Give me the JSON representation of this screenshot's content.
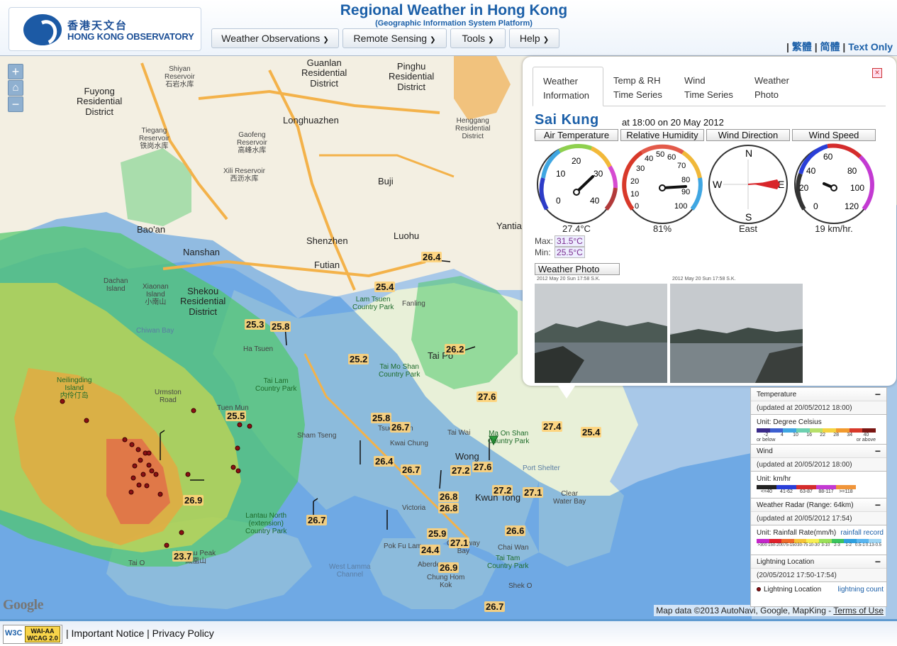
{
  "header": {
    "logo_cn": "香港天文台",
    "logo_en": "HONG KONG OBSERVATORY",
    "title": "Regional Weather in Hong Kong",
    "subtitle": "(Geographic Information System Platform)",
    "menu": [
      "Weather Observations",
      "Remote Sensing",
      "Tools",
      "Help"
    ],
    "lang": {
      "traditional": "繁體",
      "simplified": "简體",
      "text_only": "Text Only",
      "separator": "|"
    }
  },
  "map": {
    "zoom_in": "+",
    "home": "⌂",
    "zoom_out": "−",
    "google": "Google",
    "attribution": "Map data ©2013 AutoNavi, Google, MapKing - ",
    "terms": "Terms of Use",
    "labels": [
      {
        "text": "Shiyan\nReservoir\n石岩水库",
        "cls": ""
      },
      {
        "text": "Fuyong\nResidential\nDistrict",
        "cls": "big"
      },
      {
        "text": "Tiegang\nReservoir\n铁岗水库",
        "cls": ""
      },
      {
        "text": "Guanlan\nResidential\nDistrict",
        "cls": "big"
      },
      {
        "text": "Pinghu\nResidential\nDistrict",
        "cls": "big"
      },
      {
        "text": "Longhuazhen",
        "cls": "big"
      },
      {
        "text": "Gaofeng\nReservoir\n高峰水库",
        "cls": ""
      },
      {
        "text": "Xili Reservoir\n西沥水库",
        "cls": ""
      },
      {
        "text": "Bao'an",
        "cls": "big"
      },
      {
        "text": "Shenzhen",
        "cls": "big"
      },
      {
        "text": "Luohu",
        "cls": "big"
      },
      {
        "text": "Futian",
        "cls": "big"
      },
      {
        "text": "Nanshan",
        "cls": "big"
      },
      {
        "text": "Buji",
        "cls": "big"
      },
      {
        "text": "Henggang\nResidential\nDistrict",
        "cls": ""
      },
      {
        "text": "Shekou\nResidential\nDistrict",
        "cls": "big"
      },
      {
        "text": "Chiwan Bay",
        "cls": "water"
      },
      {
        "text": "Neilingding\nIsland\n内伶仃岛",
        "cls": "park"
      },
      {
        "text": "Tai Lam\nCountry Park",
        "cls": "park"
      },
      {
        "text": "Tuen Mun",
        "cls": ""
      },
      {
        "text": "Ha Tsuen",
        "cls": ""
      },
      {
        "text": "Lam Tsuen\nCountry Park",
        "cls": "park"
      },
      {
        "text": "Fanling",
        "cls": ""
      },
      {
        "text": "Tai Po",
        "cls": "big"
      },
      {
        "text": "Tai Mo Shan\nCountry Park",
        "cls": "park"
      },
      {
        "text": "Tsuen Wan",
        "cls": ""
      },
      {
        "text": "Kwai Chung",
        "cls": ""
      },
      {
        "text": "Tai Wai",
        "cls": ""
      },
      {
        "text": "Ma On Shan\nCountry Park",
        "cls": "park"
      },
      {
        "text": "Wong",
        "cls": "big"
      },
      {
        "text": "Kwun Tong",
        "cls": "big"
      },
      {
        "text": "Port Shelter",
        "cls": "water"
      },
      {
        "text": "Clear\nWater Bay",
        "cls": ""
      },
      {
        "text": "Lantau North\n(extension)\nCountry Park",
        "cls": "park"
      },
      {
        "text": "Lantau Peak\n鳳凰山",
        "cls": ""
      },
      {
        "text": "Tai O",
        "cls": ""
      },
      {
        "text": "Victoria",
        "cls": ""
      },
      {
        "text": "Causeway\nBay",
        "cls": ""
      },
      {
        "text": "Pok Fu Lam",
        "cls": ""
      },
      {
        "text": "West Lamma\nChannel",
        "cls": "water"
      },
      {
        "text": "Aberdeen",
        "cls": ""
      },
      {
        "text": "Chai Wan",
        "cls": ""
      },
      {
        "text": "Tai Tam\nCountry Park",
        "cls": "park"
      },
      {
        "text": "Shek O",
        "cls": ""
      },
      {
        "text": "Chung Hom\nKok",
        "cls": ""
      },
      {
        "text": "Sham Tseng",
        "cls": ""
      },
      {
        "text": "Dachan\nIsland",
        "cls": ""
      },
      {
        "text": "Xiaonan\nIsland\n小南山",
        "cls": ""
      },
      {
        "text": "Urmston\nRoad",
        "cls": ""
      },
      {
        "text": "Yantia",
        "cls": "big"
      }
    ],
    "temps": [
      "26.4",
      "25.4",
      "25.3",
      "25.8",
      "25.2",
      "26.2",
      "25.5",
      "25.8",
      "26.7",
      "27.6",
      "27.4",
      "25.4",
      "26.4",
      "26.7",
      "27.2",
      "27.6",
      "27.2",
      "27.1",
      "26.8",
      "26.8",
      "26.9",
      "26.7",
      "25.9",
      "24.4",
      "27.1",
      "26.6",
      "26.9",
      "26.7",
      "23.7"
    ]
  },
  "info": {
    "tabs": [
      {
        "l1": "Weather",
        "l2": "Information"
      },
      {
        "l1": "Temp & RH",
        "l2": "Time Series"
      },
      {
        "l1": "Wind",
        "l2": "Time Series"
      },
      {
        "l1": "Weather",
        "l2": "Photo"
      }
    ],
    "close": "×",
    "station": "Sai Kung",
    "time": "at 18:00 on 20 May 2012",
    "gauges": {
      "air_temp": {
        "header": "Air Temperature",
        "value": "27.4°C",
        "reading": 27.4,
        "ticks": [
          "10",
          "20",
          "30",
          "0",
          "40"
        ]
      },
      "humidity": {
        "header": "Relative Humidity",
        "value": "81%",
        "reading": 81,
        "ticks": [
          "30",
          "40",
          "50",
          "60",
          "70",
          "20",
          "80",
          "10",
          "90",
          "0",
          "100"
        ]
      },
      "wind_dir": {
        "header": "Wind Direction",
        "value": "East",
        "ticks": [
          "N",
          "W",
          "E",
          "S"
        ]
      },
      "wind_speed": {
        "header": "Wind Speed",
        "value": "19 km/hr.",
        "reading": 19,
        "ticks": [
          "40",
          "60",
          "20",
          "80",
          "100",
          "0",
          "120"
        ]
      }
    },
    "max_label": "Max:",
    "max": "31.5°C",
    "min_label": "Min:",
    "min": "25.5°C",
    "photo_header": "Weather Photo",
    "photo_stamp_1": "2012 May 20 Sun 17:58 S.K.",
    "photo_stamp_2": "2012 May 20 Sun 17:58 S.K."
  },
  "legend": {
    "temperature": {
      "title": "Temperature",
      "updated": "(updated at 20/05/2012 18:00)",
      "unit": "Unit: Degree Celsius",
      "ticks": [
        "-2\nor below",
        "4",
        "10",
        "16",
        "22",
        "28",
        "34",
        "40\nor above"
      ],
      "colors": [
        "#3a2a8a",
        "#3d5fd0",
        "#3fa6e2",
        "#6dd0b0",
        "#b7e06a",
        "#f5d341",
        "#f29a2e",
        "#d8392a",
        "#7a1612"
      ]
    },
    "wind": {
      "title": "Wind",
      "updated": "(updated at 20/05/2012 18:00)",
      "unit": "Unit: km/hr",
      "ticks": [
        "<=40",
        "41-62",
        "63-87",
        "88-117",
        ">=118"
      ],
      "colors": [
        "#222222",
        "#2a3fd8",
        "#d42c2c",
        "#c33ad2",
        "#f0953a"
      ]
    },
    "radar": {
      "title": "Weather Radar (Range: 64km)",
      "updated": "(updated at 20/05/2012 17:54)",
      "unit": "Unit: Rainfall Rate(mm/h)",
      "link": "rainfall record",
      "ticks": [
        ">300",
        "150-200",
        "75-150",
        "30-75",
        "10-30",
        "3-10",
        "2-3",
        "1-2",
        "0.5-1",
        "0.13-0.5"
      ],
      "colors": [
        "#c426c9",
        "#e0202a",
        "#f06b2a",
        "#f5c337",
        "#f8ef52",
        "#9be05a",
        "#3bc45e",
        "#2fa0de",
        "#5ab6f0",
        "#9fd6f4"
      ]
    },
    "lightning": {
      "title": "Lightning Location",
      "updated": "(20/05/2012 17:50-17:54)",
      "item": "Lightning Location",
      "link": "lightning count"
    },
    "minus": "−"
  },
  "footer": {
    "w3c": "W3C",
    "wai_1": "WAI-AA",
    "wai_2": "WCAG 2.0",
    "important_notice": "Important Notice",
    "privacy": "Privacy Policy",
    "sep": "|"
  }
}
